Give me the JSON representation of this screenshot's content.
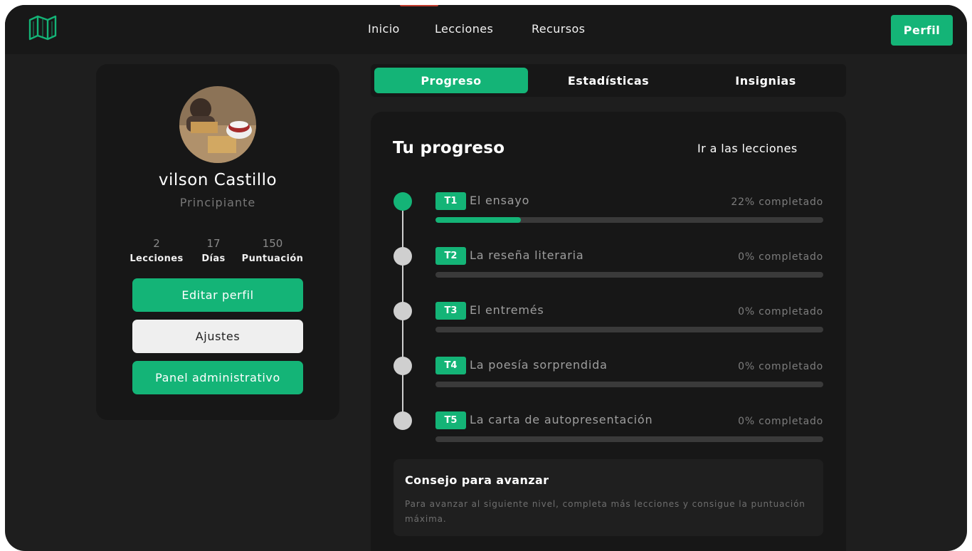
{
  "colors": {
    "accent": "#14b477",
    "background": "#1e1e1e",
    "card": "#171717"
  },
  "header": {
    "logo_icon": "map-icon",
    "nav": [
      {
        "label": "Inicio"
      },
      {
        "label": "Lecciones"
      },
      {
        "label": "Recursos"
      }
    ],
    "profile_button": "Perfil"
  },
  "profile": {
    "name": "vilson Castillo",
    "level": "Principiante",
    "stats": [
      {
        "value": "2",
        "label": "Lecciones"
      },
      {
        "value": "17",
        "label": "Días"
      },
      {
        "value": "150",
        "label": "Puntuación"
      }
    ],
    "buttons": {
      "edit": "Editar perfil",
      "settings": "Ajustes",
      "admin": "Panel administrativo"
    }
  },
  "tabs": [
    {
      "label": "Progreso",
      "active": true
    },
    {
      "label": "Estadísticas",
      "active": false
    },
    {
      "label": "Insignias",
      "active": false
    }
  ],
  "progress": {
    "title": "Tu progreso",
    "link": "Ir a las lecciones",
    "lessons": [
      {
        "code": "T1",
        "title": "El ensayo",
        "percent_text": "22% completado",
        "percent": 22,
        "status": "current"
      },
      {
        "code": "T2",
        "title": "La reseña literaria",
        "percent_text": "0% completado",
        "percent": 0,
        "status": "pending"
      },
      {
        "code": "T3",
        "title": "El entremés",
        "percent_text": "0% completado",
        "percent": 0,
        "status": "pending"
      },
      {
        "code": "T4",
        "title": "La poesía sorprendida",
        "percent_text": "0% completado",
        "percent": 0,
        "status": "pending"
      },
      {
        "code": "T5",
        "title": "La carta de autopresentación",
        "percent_text": "0% completado",
        "percent": 0,
        "status": "pending"
      }
    ]
  },
  "tip": {
    "title": "Consejo para avanzar",
    "text": "Para avanzar al siguiente nivel, completa más lecciones y consigue la puntuación máxima."
  }
}
